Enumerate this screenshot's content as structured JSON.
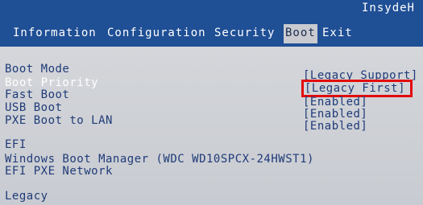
{
  "header": {
    "brand": "InsydeH"
  },
  "tabs": [
    {
      "label": "Information"
    },
    {
      "label": "Configuration"
    },
    {
      "label": "Security"
    },
    {
      "label": "Boot"
    },
    {
      "label": "Exit"
    }
  ],
  "boot": {
    "rows": [
      {
        "label": "Boot Mode",
        "value": "[Legacy Support]"
      },
      {
        "label": "Boot Priority",
        "value": "[Legacy First]"
      },
      {
        "label": "Fast Boot",
        "value": "[Enabled]"
      },
      {
        "label": "USB Boot",
        "value": "[Enabled]"
      },
      {
        "label": "PXE Boot to LAN",
        "value": "[Enabled]"
      }
    ],
    "efi_heading": "EFI",
    "efi_items": [
      {
        "label": "Windows Boot Manager (WDC WD10SPCX-24HWST1)"
      },
      {
        "label": "EFI PXE Network"
      }
    ],
    "legacy_heading": "Legacy"
  },
  "colors": {
    "header_blue": "#1f4f95",
    "text_blue": "#1f3b78",
    "selected_text": "#ffffff",
    "highlight_red": "#e30b0b",
    "background": "#cfd1d4"
  }
}
